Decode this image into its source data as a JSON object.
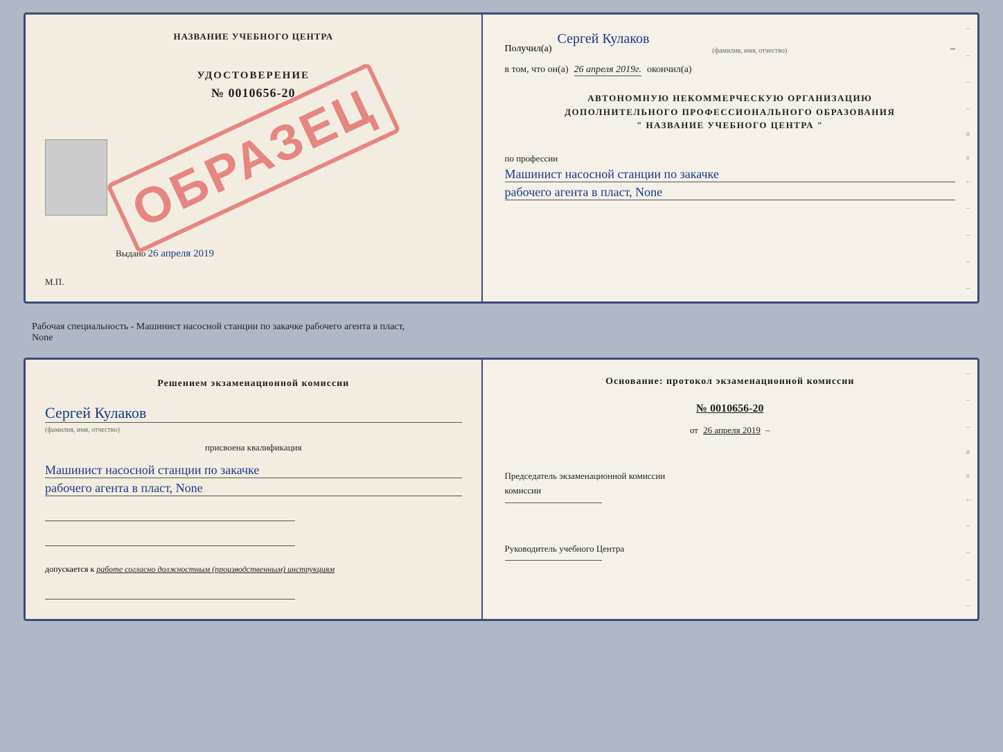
{
  "top_left": {
    "title": "НАЗВАНИЕ УЧЕБНОГО ЦЕНТРА",
    "udostoverenie_label": "УДОСТОВЕРЕНИЕ",
    "number": "№ 0010656-20",
    "vydano_label": "Выдано",
    "vydano_date": "26 апреля 2019",
    "mp_label": "М.П.",
    "stamp": "ОБРАЗЕЦ"
  },
  "top_right": {
    "poluchil_label": "Получил(а)",
    "recipient_name": "Сергей Кулаков",
    "name_sublabel": "(фамилия, имя, отчество)",
    "vtom_label": "в том, что он(а)",
    "date_val": "26 апреля 2019г.",
    "okonchil_label": "окончил(а)",
    "org_line1": "АВТОНОМНУЮ НЕКОММЕРЧЕСКУЮ ОРГАНИЗАЦИЮ",
    "org_line2": "ДОПОЛНИТЕЛЬНОГО ПРОФЕССИОНАЛЬНОГО ОБРАЗОВАНИЯ",
    "org_line3": "\"  НАЗВАНИЕ УЧЕБНОГО ЦЕНТРА  \"",
    "po_professii_label": "по профессии",
    "profession_line1": "Машинист насосной станции по закачке",
    "profession_line2": "рабочего агента в пласт, None"
  },
  "separator": {
    "text": "Рабочая специальность - Машинист насосной станции по закачке рабочего агента в пласт,",
    "text2": "None"
  },
  "bottom_left": {
    "komissia_text": "Решением  экзаменационной  комиссии",
    "person_name": "Сергей Кулаков",
    "name_sublabel": "(фамилия, имя, отчество)",
    "prisvoena_label": "присвоена квалификация",
    "qualification_line1": "Машинист насосной станции по закачке",
    "qualification_line2": "рабочего агента в пласт, None",
    "dopusk_label": "допускается к",
    "dopusk_text": "работе согласно должностным (производственным) инструкциям"
  },
  "bottom_right": {
    "osnov_label": "Основание:  протокол  экзаменационной  комиссии",
    "protocol_number": "№  0010656-20",
    "ot_label": "от",
    "ot_date": "26 апреля 2019",
    "predsedatel_label": "Председатель экзаменационной комиссии",
    "rukov_label": "Руководитель учебного Центра"
  }
}
